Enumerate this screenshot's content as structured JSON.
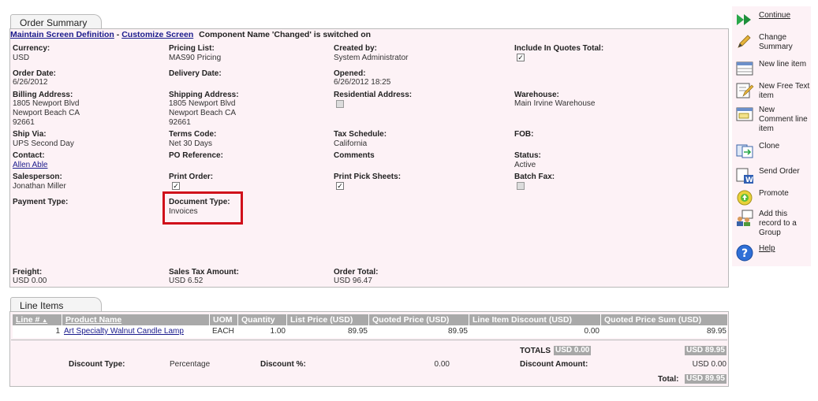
{
  "order_summary": {
    "tab_label": "Order Summary",
    "links": {
      "maintain": "Maintain Screen Definition",
      "sep": "-",
      "customize": "Customize Screen"
    },
    "component_notice": "Component Name 'Changed' is switched on",
    "fields": {
      "currency": {
        "label": "Currency:",
        "value": "USD"
      },
      "pricing_list": {
        "label": "Pricing List:",
        "value": "MAS90 Pricing"
      },
      "created_by": {
        "label": "Created by:",
        "value": "System Administrator"
      },
      "include_quotes": {
        "label": "Include In Quotes Total:",
        "checked": true
      },
      "order_date": {
        "label": "Order Date:",
        "value": "6/26/2012"
      },
      "delivery_date": {
        "label": "Delivery Date:",
        "value": ""
      },
      "opened": {
        "label": "Opened:",
        "value": "6/26/2012 18:25"
      },
      "billing_address": {
        "label": "Billing Address:",
        "line1": "1805 Newport Blvd",
        "line2": "Newport Beach CA",
        "line3": "92661"
      },
      "shipping_address": {
        "label": "Shipping Address:",
        "line1": "1805 Newport Blvd",
        "line2": "Newport Beach CA",
        "line3": "92661"
      },
      "residential_address": {
        "label": "Residential Address:",
        "checked": false
      },
      "warehouse": {
        "label": "Warehouse:",
        "value": "Main Irvine Warehouse"
      },
      "ship_via": {
        "label": "Ship Via:",
        "value": "UPS Second Day"
      },
      "terms_code": {
        "label": "Terms Code:",
        "value": "Net 30 Days"
      },
      "tax_schedule": {
        "label": "Tax Schedule:",
        "value": "California"
      },
      "fob": {
        "label": "FOB:",
        "value": ""
      },
      "contact": {
        "label": "Contact:",
        "value": "Allen Able"
      },
      "po_reference": {
        "label": "PO Reference:",
        "value": ""
      },
      "comments": {
        "label": "Comments",
        "value": ""
      },
      "status": {
        "label": "Status:",
        "value": "Active"
      },
      "salesperson": {
        "label": "Salesperson:",
        "value": "Jonathan Miller"
      },
      "print_order": {
        "label": "Print Order:",
        "checked": true
      },
      "print_pick_sheets": {
        "label": "Print Pick Sheets:",
        "checked": true
      },
      "batch_fax": {
        "label": "Batch Fax:",
        "checked": false
      },
      "payment_type": {
        "label": "Payment Type:",
        "value": ""
      },
      "document_type": {
        "label": "Document Type:",
        "value": "Invoices"
      },
      "freight": {
        "label": "Freight:",
        "value": "USD 0.00"
      },
      "sales_tax_amount": {
        "label": "Sales Tax Amount:",
        "value": "USD 6.52"
      },
      "order_total": {
        "label": "Order Total:",
        "value": "USD 96.47"
      }
    }
  },
  "line_items": {
    "tab_label": "Line Items",
    "columns": [
      "Line #",
      "Product Name",
      "UOM",
      "Quantity",
      "List Price (USD)",
      "Quoted Price (USD)",
      "Line Item Discount (USD)",
      "Quoted Price Sum (USD)"
    ],
    "sort_indicator": "▲",
    "rows": [
      {
        "line": "1",
        "product": "Art Specialty Walnut Candle Lamp",
        "uom": "EACH",
        "quantity": "1.00",
        "list_price": "89.95",
        "quoted_price": "89.95",
        "discount": "0.00",
        "sum": "89.95"
      }
    ],
    "totals": {
      "label": "TOTALS",
      "discount_total": "USD 0.00",
      "sum_total": "USD 89.95",
      "discount_type_label": "Discount Type:",
      "discount_type_value": "Percentage",
      "discount_pct_label": "Discount %:",
      "discount_pct_value": "0.00",
      "discount_amount_label": "Discount Amount:",
      "discount_amount_value": "USD 0.00",
      "total_label": "Total:",
      "total_value": "USD 89.95"
    }
  },
  "sidebar": {
    "items": [
      {
        "label": "Continue"
      },
      {
        "label": "Change Summary"
      },
      {
        "label": "New line item"
      },
      {
        "label": "New Free Text item"
      },
      {
        "label": "New Comment line item"
      },
      {
        "label": "Clone"
      },
      {
        "label": "Send Order"
      },
      {
        "label": "Promote"
      },
      {
        "label": "Add this record to a Group"
      },
      {
        "label": "Help"
      }
    ]
  },
  "colors": {
    "panel_bg": "#fdf2f6",
    "header_grey": "#a9a9a9",
    "link": "#1a1a8c",
    "highlight": "#d0101a"
  }
}
